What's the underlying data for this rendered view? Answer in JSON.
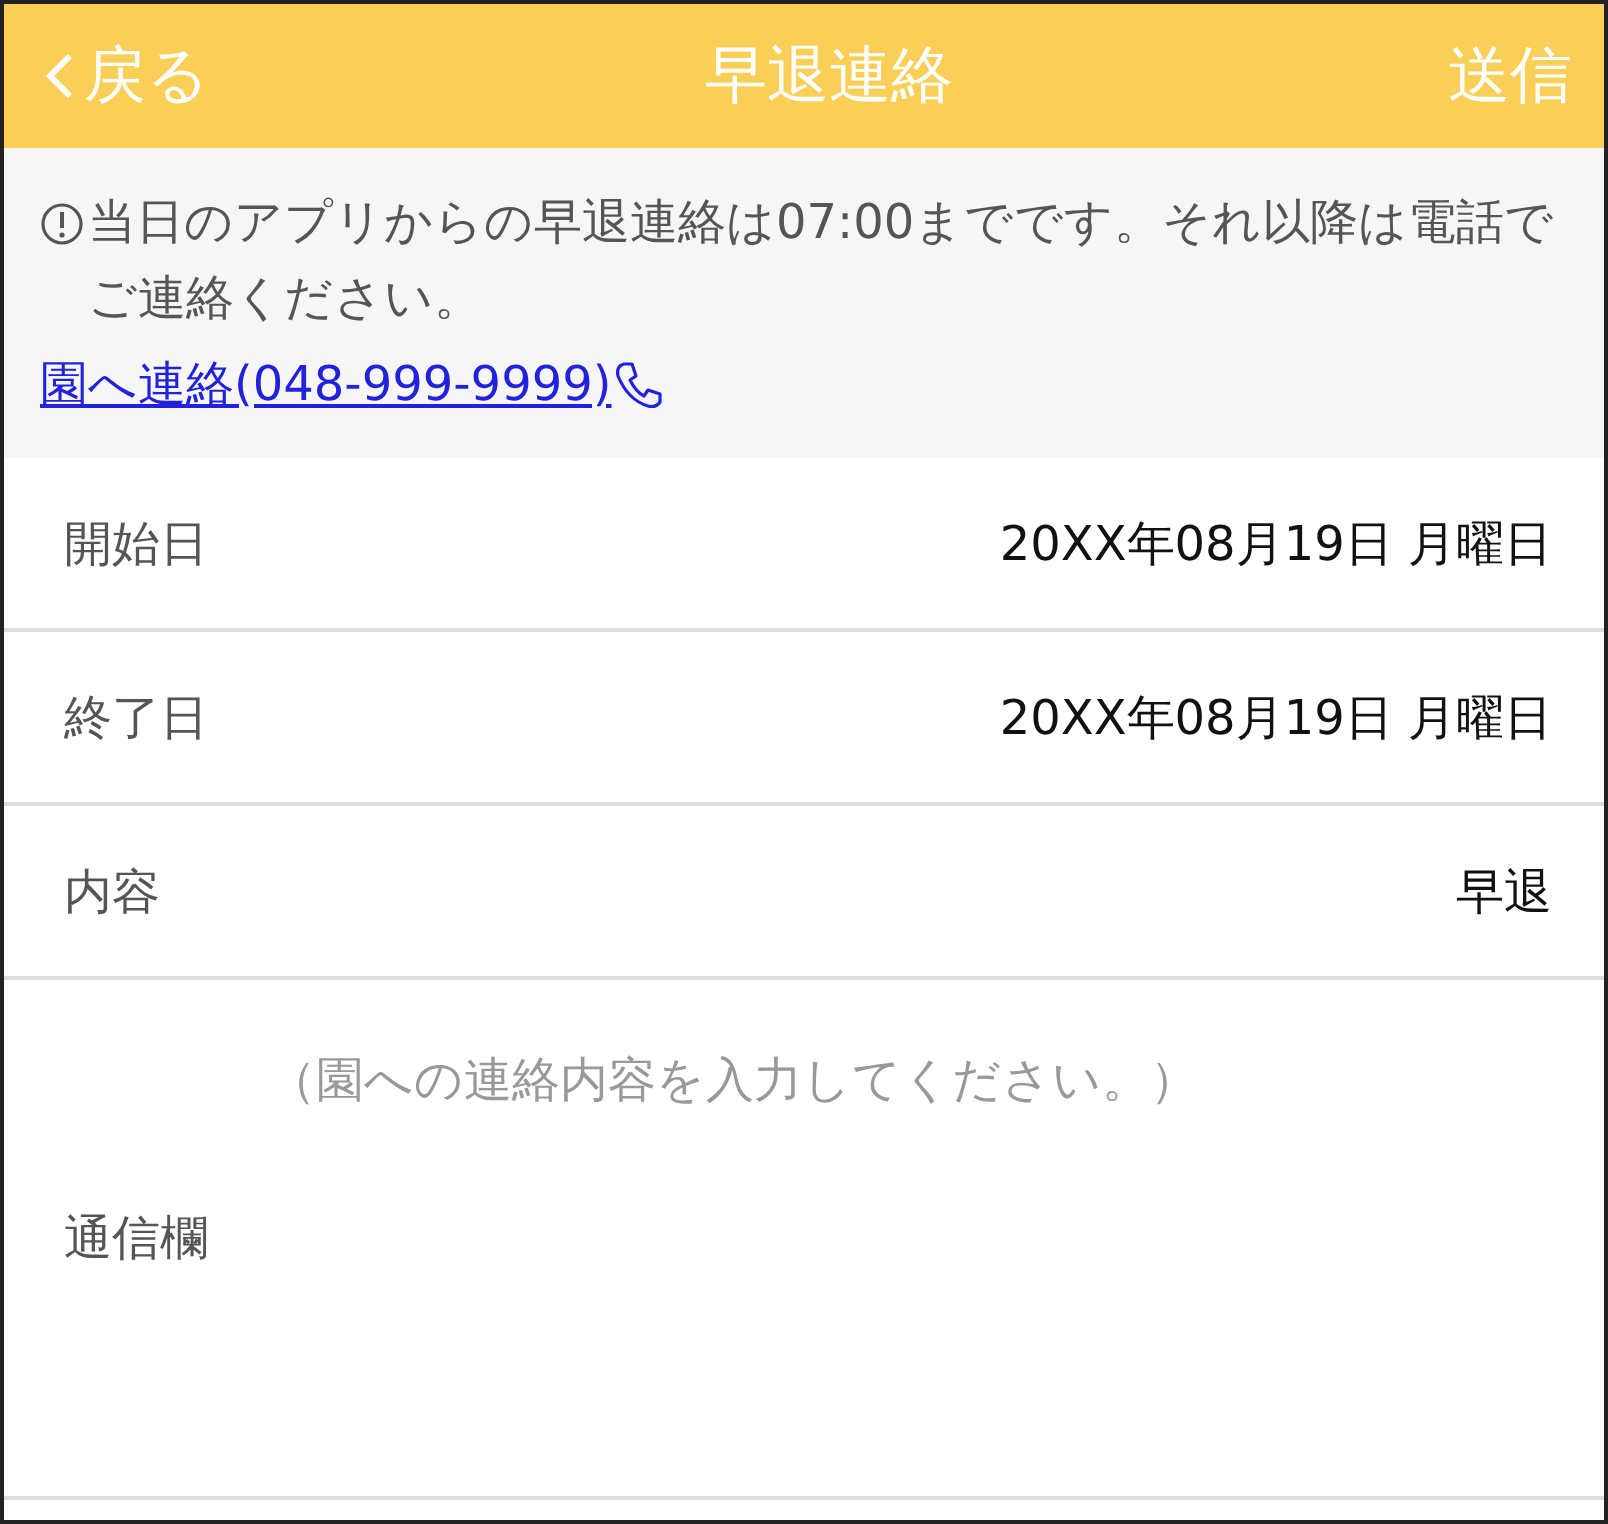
{
  "header": {
    "back": "戻る",
    "title": "早退連絡",
    "action": "送信"
  },
  "notice": {
    "text": "当日のアプリからの早退連絡は07:00までです。それ以降は電話でご連絡ください。",
    "link": "園へ連絡(048-999-9999)"
  },
  "rows": [
    {
      "label": "開始日",
      "value": "20XX年08月19日 月曜日"
    },
    {
      "label": "終了日",
      "value": "20XX年08月19日 月曜日"
    },
    {
      "label": "内容",
      "value": "早退"
    }
  ],
  "message": {
    "label": "通信欄",
    "placeholder": "（園への連絡内容を入力してください。）"
  }
}
